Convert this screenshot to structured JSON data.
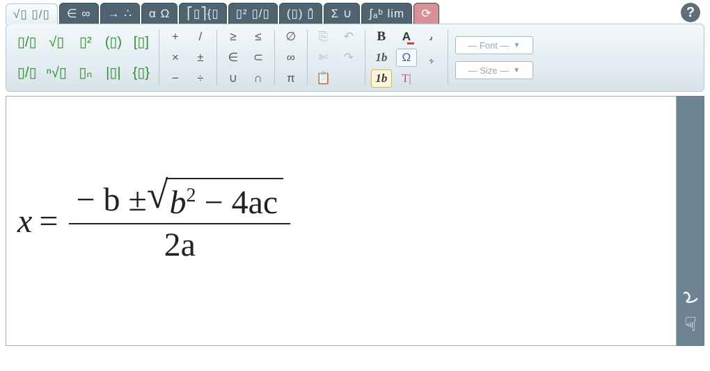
{
  "tabs": [
    {
      "label": "√▯ ▯/▯",
      "active": true
    },
    {
      "label": "∈ ∞"
    },
    {
      "label": "→ ∴"
    },
    {
      "label": "α Ω"
    },
    {
      "label": "⎡▯⎤{▯"
    },
    {
      "label": "▯² ▯/▯"
    },
    {
      "label": "(▯) ▯̂"
    },
    {
      "label": "Σ ∪"
    },
    {
      "label": "∫ₐᵇ lim"
    },
    {
      "label": "⟳",
      "record": true
    }
  ],
  "help": "?",
  "templates": {
    "r0": [
      "▯/▯",
      "√▯",
      "▯²",
      "(▯)",
      "[▯]"
    ],
    "r1": [
      "▯/▯",
      "ⁿ√▯",
      "▯ₙ",
      "|▯|",
      "{▯}"
    ]
  },
  "ops": {
    "c0": [
      "+",
      "×",
      "−"
    ],
    "c1": [
      "/",
      "±",
      "÷"
    ],
    "c2": [
      "≥",
      "∈",
      "∪"
    ],
    "c3": [
      "≤",
      "⊂",
      "∩"
    ],
    "c4": [
      "∅",
      "∞",
      "π"
    ]
  },
  "clipboard": {
    "c0": [
      "⎘",
      "✄",
      "📋"
    ],
    "c1": [
      "↶",
      "↷",
      ""
    ]
  },
  "format": {
    "c0": [
      "B",
      "1b",
      "1b"
    ],
    "c1": [
      "A",
      "Ω",
      "T|"
    ],
    "c2": [
      "ﯨ",
      "ﮩ",
      ""
    ]
  },
  "font_combo": "— Font —",
  "size_combo": "— Size —",
  "equation": {
    "lhs": "x",
    "rel": "=",
    "num_prefix": "− b ±",
    "radicand": "b",
    "radicand_exp": "2",
    "radicand_tail": "− 4ac",
    "den": "2a"
  }
}
